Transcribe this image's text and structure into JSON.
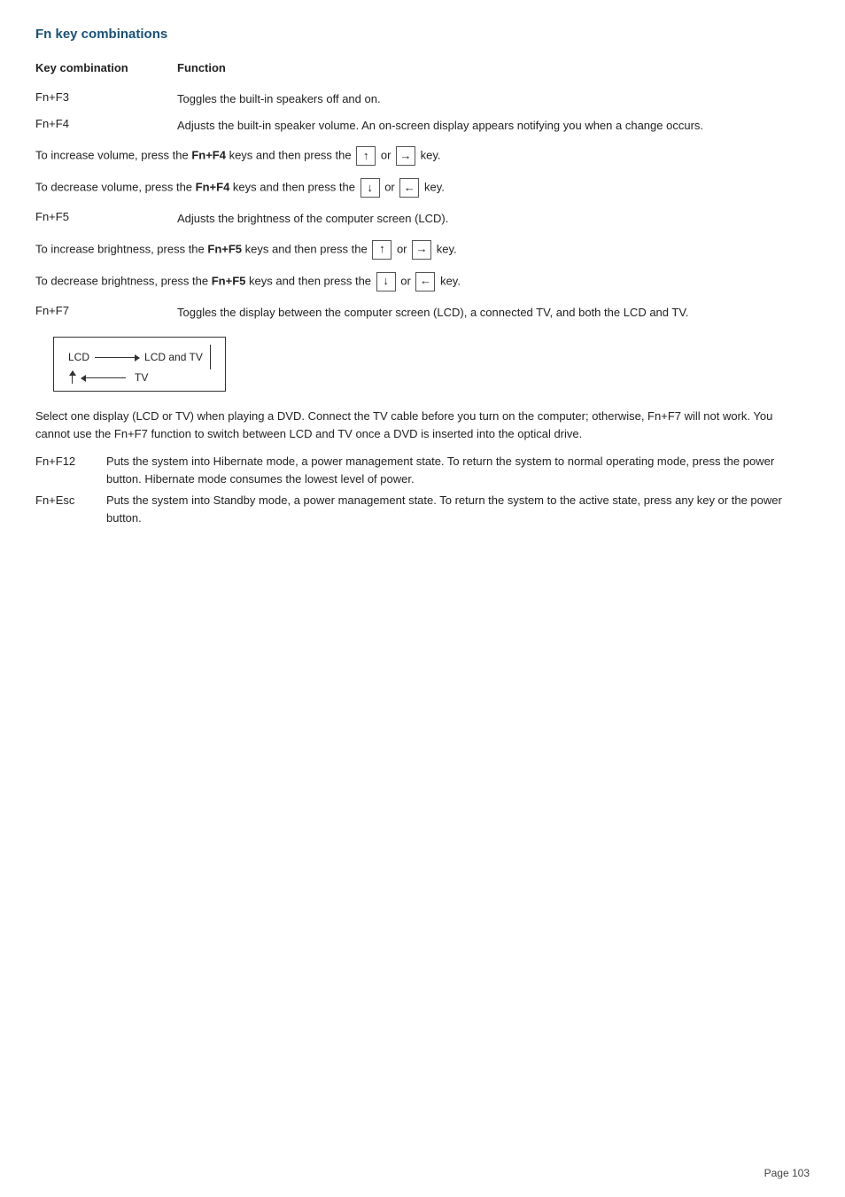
{
  "page": {
    "title": "Fn key combinations",
    "header": {
      "key_combination": "Key combination",
      "function": "Function"
    },
    "entries": [
      {
        "key": "Fn+F3",
        "description": "Toggles the built-in speakers off and on."
      },
      {
        "key": "Fn+F4",
        "description": "Adjusts the built-in speaker volume. An on-screen display appears notifying you when a change occurs."
      },
      {
        "key": "Fn+F5",
        "description": "Adjusts the brightness of the computer screen (LCD)."
      },
      {
        "key": "Fn+F7",
        "description": "Toggles the display between the computer screen (LCD), a connected TV, and both the LCD and TV."
      },
      {
        "key": "Fn+F12",
        "description": "Puts the system into Hibernate mode, a power management state. To return the system to normal operating mode, press the power button. Hibernate mode consumes the lowest level of power."
      },
      {
        "key": "Fn+Esc",
        "description": "Puts the system into Standby mode, a power management state. To return the system to the active state, press any key or the power button."
      }
    ],
    "volume_increase": "To increase volume, press the ",
    "volume_increase_keys": "Fn+F4",
    "volume_increase_suffix": " keys and then press the ",
    "volume_increase_arrows": "↑ or → key.",
    "volume_decrease": "To decrease volume, press the ",
    "volume_decrease_keys": "Fn+F4",
    "volume_decrease_suffix": " keys and then press the ",
    "volume_decrease_arrows": "↓ or ← key.",
    "brightness_increase": "To increase brightness, press the ",
    "brightness_increase_keys": "Fn+F5",
    "brightness_increase_suffix": " keys and then press the ",
    "brightness_increase_arrows": "↑ or → key.",
    "brightness_decrease": "To decrease brightness, press the ",
    "brightness_decrease_keys": "Fn+F5",
    "brightness_decrease_suffix": " keys and then press the ",
    "brightness_decrease_arrows": "↓ or ← key.",
    "diagram_labels": {
      "lcd": "LCD",
      "lcd_and_tv": "LCD and TV",
      "tv": "TV"
    },
    "select_note": "Select one display (LCD or TV) when playing a DVD. Connect the TV cable before you turn on the computer; otherwise, Fn+F7 will not work. You cannot use the Fn+F7 function to switch between LCD and TV once a DVD is inserted into the optical drive.",
    "page_number": "Page 103"
  }
}
